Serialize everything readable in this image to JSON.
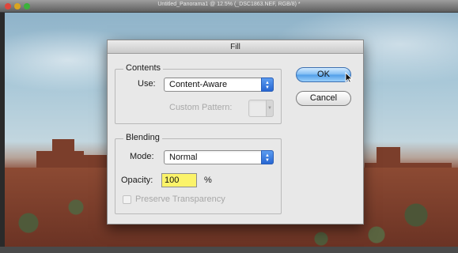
{
  "window": {
    "title": "Untitled_Panorama1 @ 12.5% (_DSC1863.NEF, RGB/8) *"
  },
  "dialog": {
    "title": "Fill",
    "contents": {
      "group_label": "Contents",
      "use_label": "Use:",
      "use_value": "Content-Aware",
      "custom_pattern_label": "Custom Pattern:"
    },
    "blending": {
      "group_label": "Blending",
      "mode_label": "Mode:",
      "mode_value": "Normal",
      "opacity_label": "Opacity:",
      "opacity_value": "100",
      "opacity_unit": "%",
      "preserve_transparency_label": "Preserve Transparency",
      "preserve_transparency_checked": false
    },
    "buttons": {
      "ok_label": "OK",
      "cancel_label": "Cancel"
    }
  },
  "icons": {
    "popup_arrows": "up-down-arrows-icon",
    "cursor": "pointer-cursor-icon"
  },
  "colors": {
    "default_button": "#4f9de8",
    "focused_input": "#fbf36a"
  }
}
